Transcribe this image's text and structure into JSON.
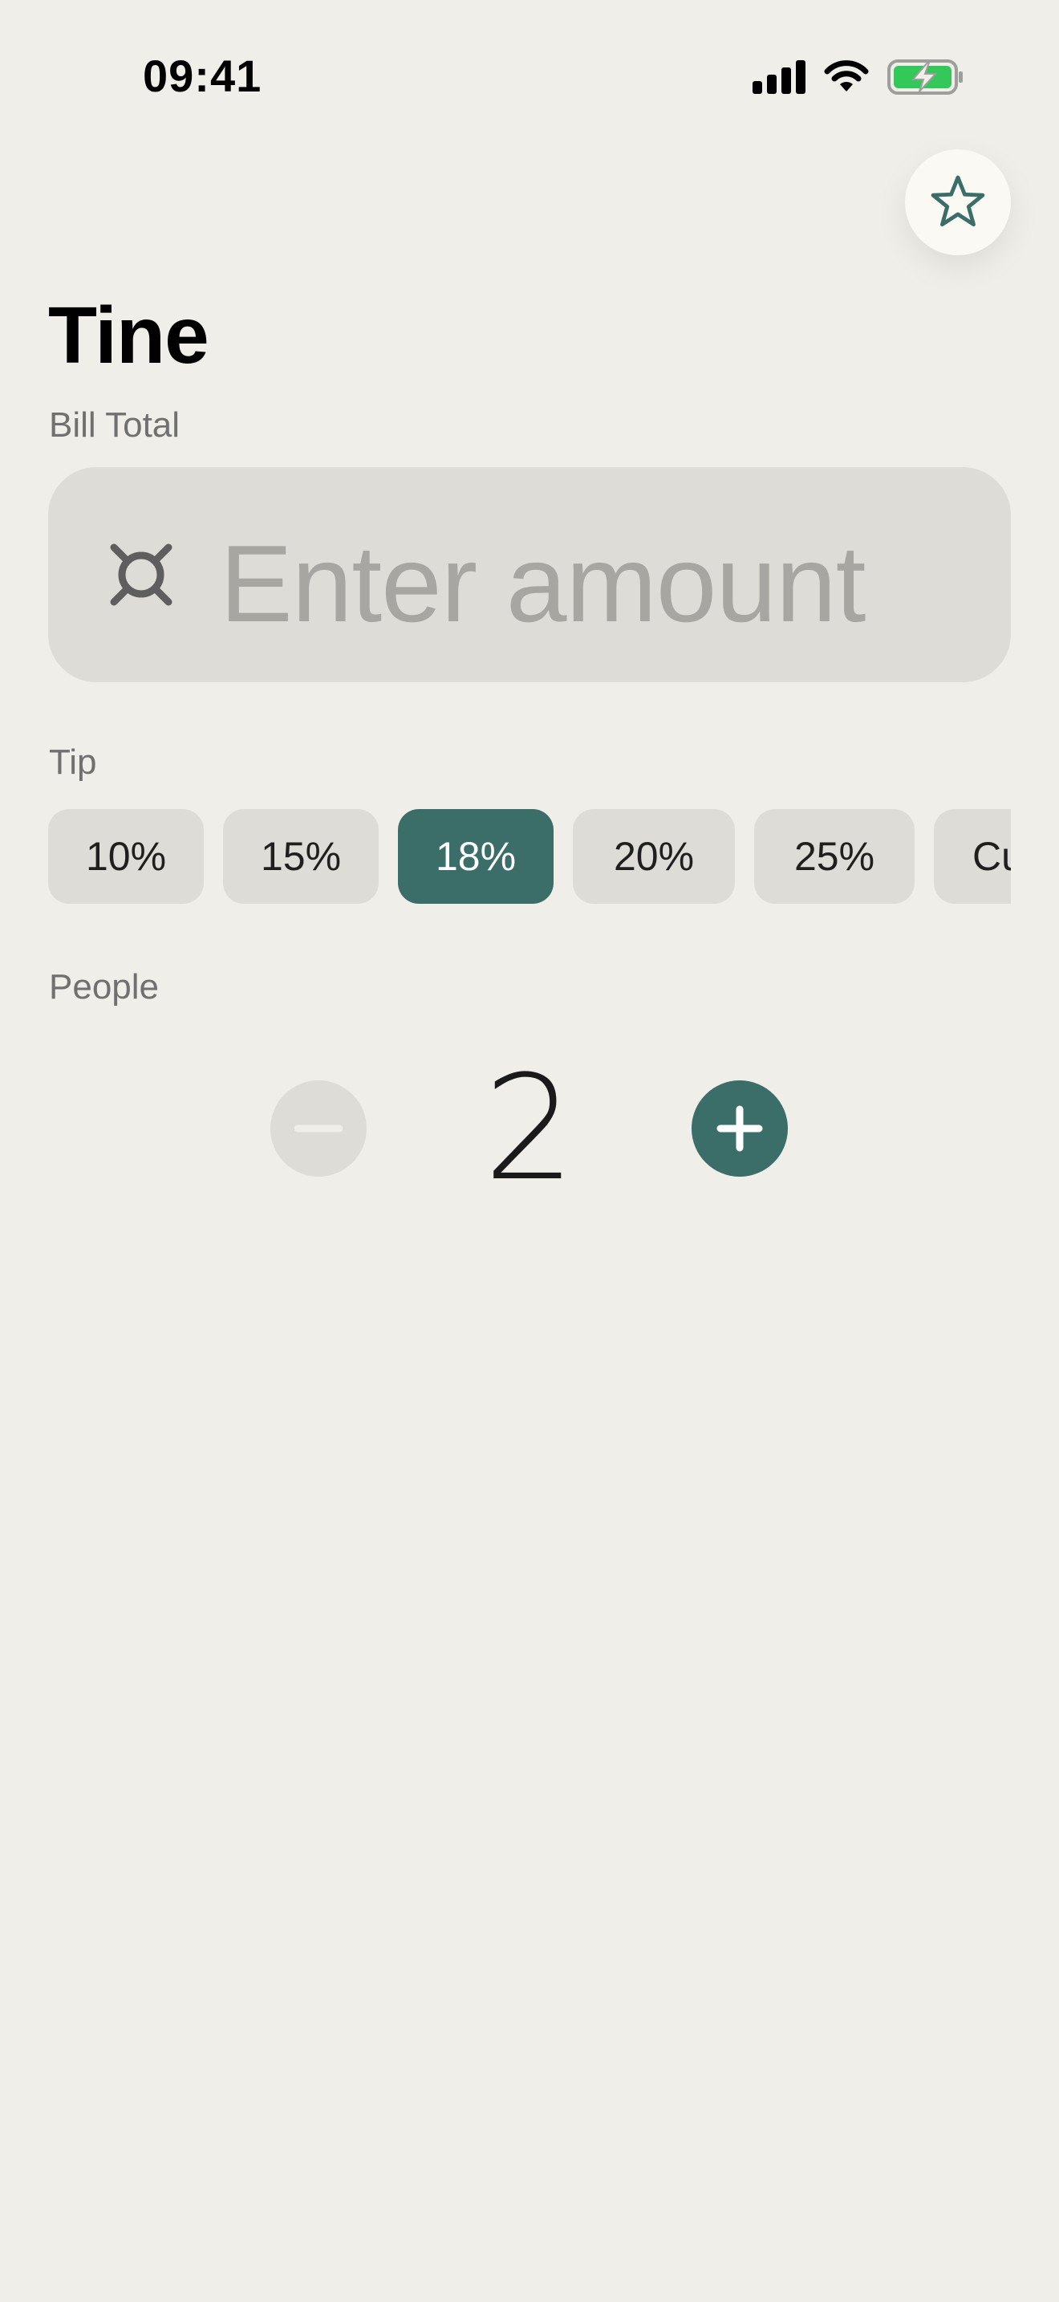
{
  "status_bar": {
    "time": "09:41",
    "icons": [
      "cellular-signal-icon",
      "wifi-icon",
      "battery-charging-icon"
    ]
  },
  "favorite": {
    "icon": "star-icon"
  },
  "app": {
    "title": "Tine"
  },
  "bill": {
    "label": "Bill Total",
    "currency_icon": "generic-currency-icon",
    "placeholder": "Enter amount",
    "value": ""
  },
  "tip": {
    "label": "Tip",
    "options": [
      "10%",
      "15%",
      "18%",
      "20%",
      "25%",
      "Cu"
    ],
    "selected": "18%"
  },
  "people": {
    "label": "People",
    "count": "2",
    "decrement_icon": "minus-icon",
    "increment_icon": "plus-icon"
  },
  "colors": {
    "background": "#F0EEE9",
    "accent": "#3B6E69",
    "field": "#DEDCD7",
    "label": "#707070",
    "placeholder": "#A8A6A2",
    "battery_green": "#34C759"
  }
}
